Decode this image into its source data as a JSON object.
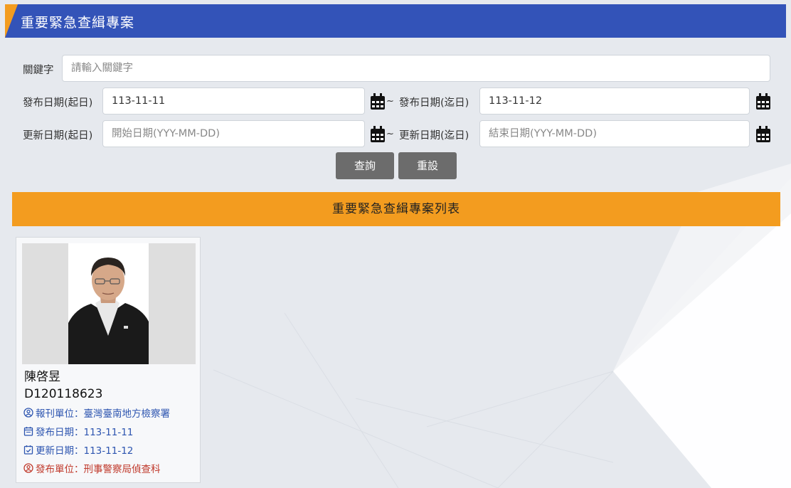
{
  "header": {
    "title": "重要緊急查緝專案"
  },
  "search": {
    "keyword_label": "關鍵字",
    "keyword_placeholder": "請輸入關鍵字",
    "publish_start_label": "發布日期(起日)",
    "publish_start_value": "113-11-11",
    "publish_end_label": "發布日期(迄日)",
    "publish_end_value": "113-11-12",
    "update_start_label": "更新日期(起日)",
    "update_start_placeholder": "開始日期(YYY-MM-DD)",
    "update_end_label": "更新日期(迄日)",
    "update_end_placeholder": "結束日期(YYY-MM-DD)",
    "tilde": "~",
    "query_button": "查詢",
    "reset_button": "重設"
  },
  "list": {
    "title": "重要緊急查緝專案列表",
    "cards": [
      {
        "name": "陳啓昱",
        "id_number": "D120118623",
        "report_unit": "報刊單位：臺灣臺南地方檢察署",
        "publish_date": "發布日期：113-11-11",
        "update_date": "更新日期：113-11-12",
        "publish_unit": "發布單位：刑事警察局偵查科"
      }
    ]
  },
  "colors": {
    "header_bg": "#3353b8",
    "accent_orange": "#f39c1f",
    "button_gray": "#6c6c6c",
    "info_blue": "#2d55b0",
    "info_red": "#c0392b"
  }
}
